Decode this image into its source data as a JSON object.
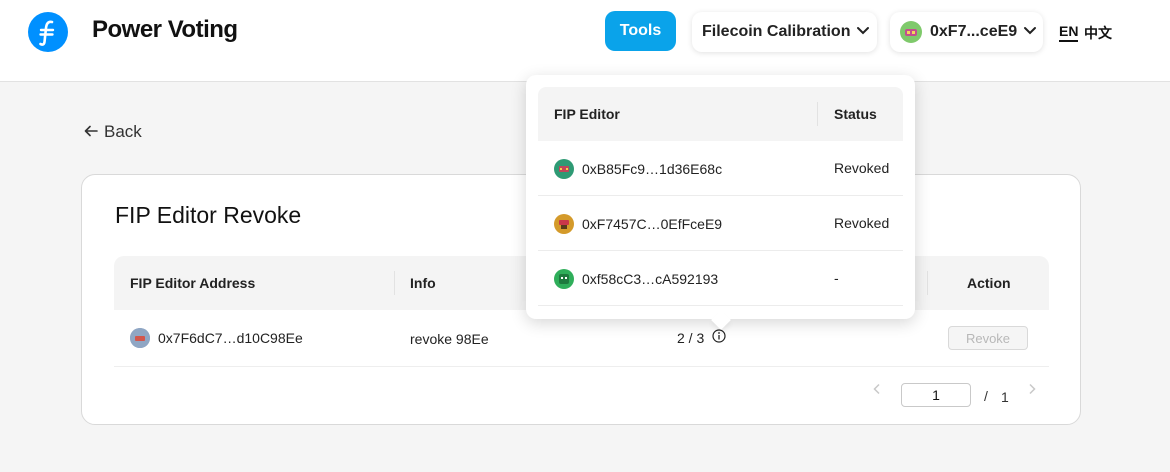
{
  "header": {
    "brand": "Power Voting",
    "tools_label": "Tools",
    "network_label": "Filecoin Calibration",
    "wallet_label": "0xF7...ceE9",
    "lang_en": "EN",
    "lang_zh": "中文"
  },
  "back_label": "Back",
  "card": {
    "title": "FIP Editor Revoke",
    "columns": {
      "address": "FIP Editor Address",
      "info": "Info",
      "action": "Action"
    },
    "row": {
      "address": "0x7F6dC7…d10C98Ee",
      "info": "revoke 98Ee",
      "votes": "2 / 3",
      "action": "Revoke"
    }
  },
  "pagination": {
    "current_page": "1",
    "separator": "/",
    "total_pages": "1"
  },
  "popover": {
    "columns": {
      "editor": "FIP Editor",
      "status": "Status"
    },
    "rows": [
      {
        "address": "0xB85Fc9…1d36E68c",
        "status": "Revoked",
        "avatar_color": "#2e9a74"
      },
      {
        "address": "0xF7457C…0EfFceE9",
        "status": "Revoked",
        "avatar_color": "#d49a2a"
      },
      {
        "address": "0xf58cC3…cA592193",
        "status": "-",
        "avatar_color": "#2fae5a"
      }
    ]
  },
  "colors": {
    "accent": "#0aa3ea",
    "logo": "#0090ff"
  },
  "icons": [
    "filecoin-logo-icon",
    "chevron-down-icon",
    "arrow-left-icon",
    "info-icon",
    "chevron-left-icon",
    "chevron-right-icon"
  ]
}
